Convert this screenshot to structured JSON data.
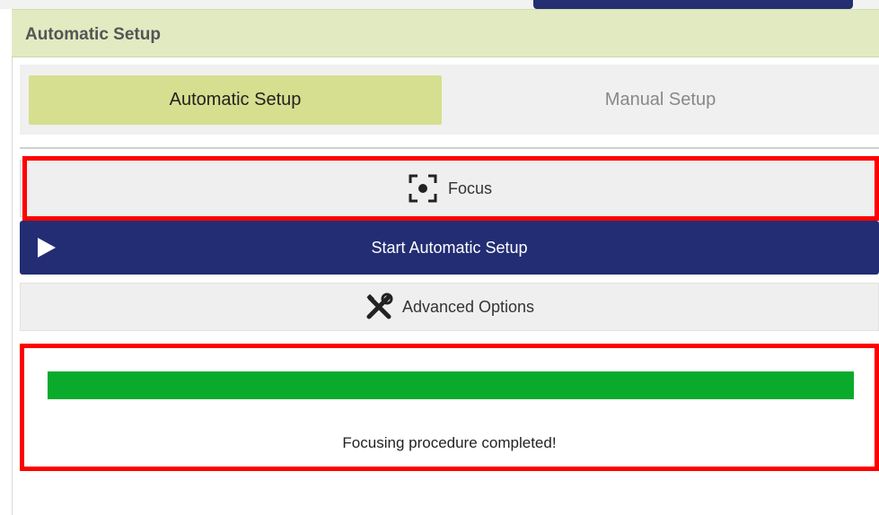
{
  "panel": {
    "title": "Automatic Setup"
  },
  "tabs": [
    {
      "label": "Automatic Setup",
      "active": true
    },
    {
      "label": "Manual Setup",
      "active": false
    }
  ],
  "buttons": {
    "focus": {
      "label": "Focus",
      "icon": "focus-target-icon"
    },
    "start": {
      "label": "Start Automatic Setup",
      "icon": "play-icon"
    },
    "advanced": {
      "label": "Advanced Options",
      "icon": "tools-icon"
    }
  },
  "progress": {
    "value_percent": 100,
    "status": "Focusing procedure completed!"
  },
  "colors": {
    "header_bg": "#e2eac2",
    "active_tab": "#d6df8f",
    "primary": "#222d73",
    "progress": "#0aab2c",
    "highlight": "#ff0000"
  }
}
